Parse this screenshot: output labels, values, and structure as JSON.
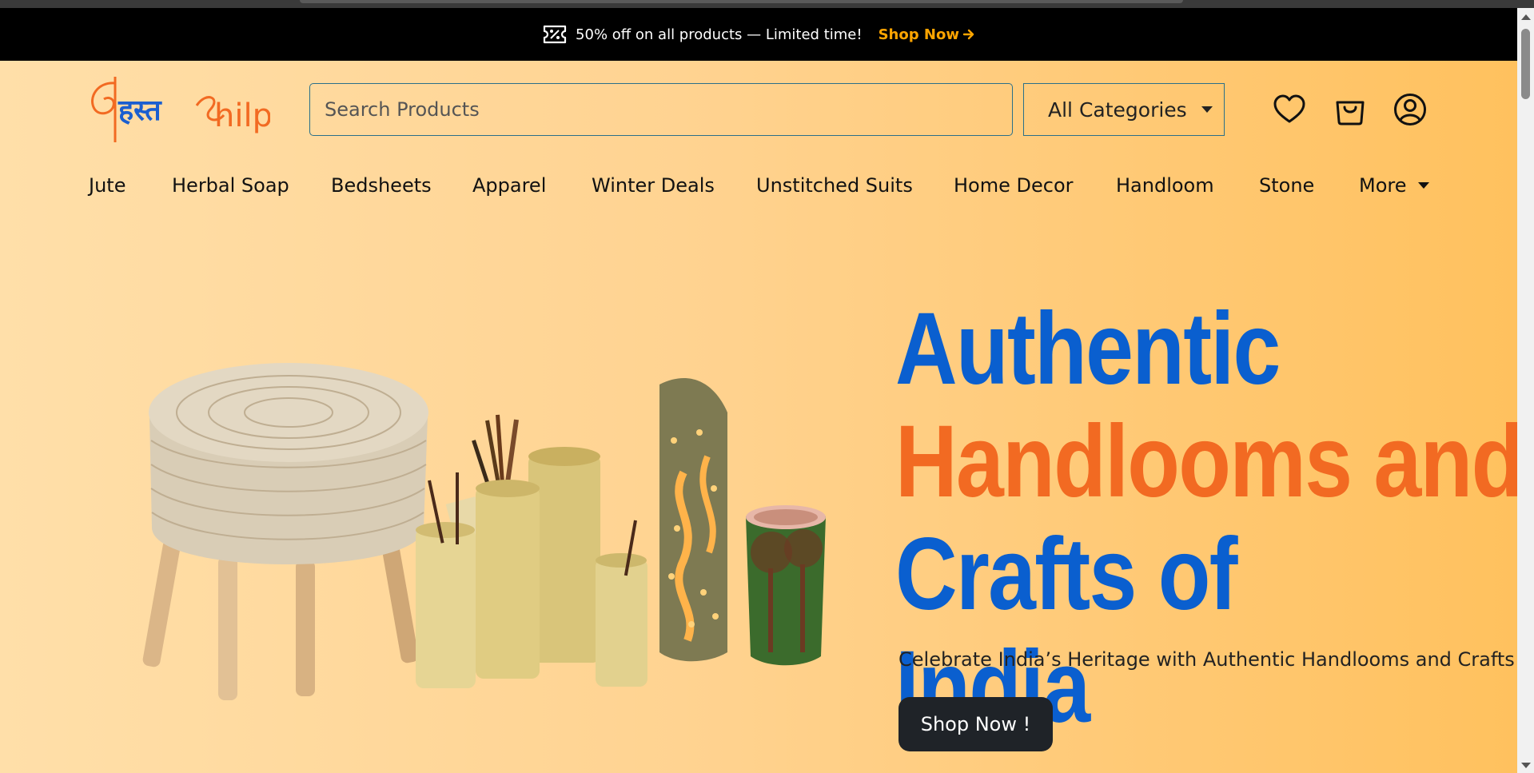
{
  "promo": {
    "icon": "discount-tag-icon",
    "text": "50% off on all products — Limited time!",
    "link_label": "Shop Now"
  },
  "header": {
    "logo_text_devanagari": "हस्त",
    "logo_text_latin": "Shilp",
    "search_placeholder": "Search Products",
    "category_label": "All Categories",
    "icons": [
      "heart-icon",
      "shopping-bag-icon",
      "user-icon"
    ]
  },
  "nav": {
    "items": [
      "Jute",
      "Herbal Soap",
      "Bedsheets",
      "Apparel",
      "Winter Deals",
      "Unstitched Suits",
      "Home Decor",
      "Handloom",
      "Stone"
    ],
    "more_label": "More"
  },
  "hero": {
    "headline_line1": "Authentic",
    "headline_line2": "Handlooms and",
    "headline_line3": "Crafts of India",
    "subtitle": "Celebrate India’s Heritage with Authentic Handlooms and Crafts",
    "cta_label": "Shop Now !"
  },
  "colors": {
    "promo_bg": "#000000",
    "promo_link": "#ffa500",
    "brand_blue": "#0a5fcf",
    "brand_orange": "#f26a22",
    "cta_bg": "#1f2328"
  }
}
